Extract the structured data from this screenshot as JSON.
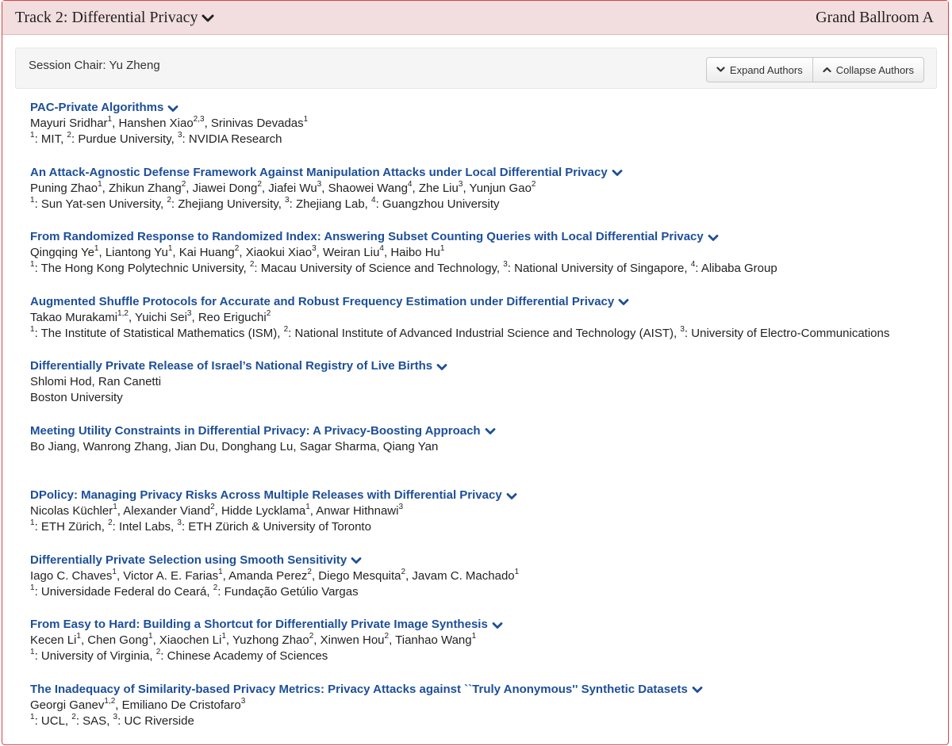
{
  "track": {
    "title": "Track 2: Differential Privacy",
    "room": "Grand Ballroom A"
  },
  "session": {
    "chair": "Session Chair: Yu Zheng",
    "expand_label": "Expand Authors",
    "collapse_label": "Collapse Authors"
  },
  "icons": {
    "track_toggle": "chevron-down-icon",
    "expand": "chevron-down-icon",
    "collapse": "chevron-up-icon",
    "paper_toggle": "chevron-down-icon"
  },
  "colors": {
    "header_bg": "#f2dede",
    "border": "#d8434a",
    "link": "#1d4f99"
  },
  "papers": [
    {
      "title": "PAC-Private Algorithms",
      "authors": [
        {
          "name": "Mayuri Sridhar",
          "sup": "1"
        },
        {
          "name": "Hanshen Xiao",
          "sup": "2,3"
        },
        {
          "name": "Srinivas Devadas",
          "sup": "1"
        }
      ],
      "affiliations": [
        {
          "sup": "1",
          "name": "MIT"
        },
        {
          "sup": "2",
          "name": "Purdue University"
        },
        {
          "sup": "3",
          "name": "NVIDIA Research"
        }
      ]
    },
    {
      "title": "An Attack-Agnostic Defense Framework Against Manipulation Attacks under Local Differential Privacy",
      "authors": [
        {
          "name": "Puning Zhao",
          "sup": "1"
        },
        {
          "name": "Zhikun Zhang",
          "sup": "2"
        },
        {
          "name": "Jiawei Dong",
          "sup": "2"
        },
        {
          "name": "Jiafei Wu",
          "sup": "3"
        },
        {
          "name": "Shaowei Wang",
          "sup": "4"
        },
        {
          "name": "Zhe Liu",
          "sup": "3"
        },
        {
          "name": "Yunjun Gao",
          "sup": "2"
        }
      ],
      "affiliations": [
        {
          "sup": "1",
          "name": "Sun Yat-sen University"
        },
        {
          "sup": "2",
          "name": "Zhejiang University"
        },
        {
          "sup": "3",
          "name": "Zhejiang Lab"
        },
        {
          "sup": "4",
          "name": "Guangzhou University"
        }
      ]
    },
    {
      "title": "From Randomized Response to Randomized Index: Answering Subset Counting Queries with Local Differential Privacy",
      "authors": [
        {
          "name": "Qingqing Ye",
          "sup": "1"
        },
        {
          "name": "Liantong Yu",
          "sup": "1"
        },
        {
          "name": "Kai Huang",
          "sup": "2"
        },
        {
          "name": "Xiaokui Xiao",
          "sup": "3"
        },
        {
          "name": "Weiran Liu",
          "sup": "4"
        },
        {
          "name": "Haibo Hu",
          "sup": "1"
        }
      ],
      "affiliations": [
        {
          "sup": "1",
          "name": "The Hong Kong Polytechnic University"
        },
        {
          "sup": "2",
          "name": "Macau University of Science and Technology"
        },
        {
          "sup": "3",
          "name": "National University of Singapore"
        },
        {
          "sup": "4",
          "name": "Alibaba Group"
        }
      ]
    },
    {
      "title": "Augmented Shuffle Protocols for Accurate and Robust Frequency Estimation under Differential Privacy",
      "authors": [
        {
          "name": "Takao Murakami",
          "sup": "1,2"
        },
        {
          "name": "Yuichi Sei",
          "sup": "3"
        },
        {
          "name": "Reo Eriguchi",
          "sup": "2"
        }
      ],
      "affiliations": [
        {
          "sup": "1",
          "name": "The Institute of Statistical Mathematics (ISM)"
        },
        {
          "sup": "2",
          "name": "National Institute of Advanced Industrial Science and Technology (AIST)"
        },
        {
          "sup": "3",
          "name": "University of Electro-Communications"
        }
      ]
    },
    {
      "title": "Differentially Private Release of Israel’s National Registry of Live Births",
      "authors": [
        {
          "name": "Shlomi Hod",
          "sup": ""
        },
        {
          "name": "Ran Canetti",
          "sup": ""
        }
      ],
      "affiliations": [
        {
          "sup": "",
          "name": "Boston University"
        }
      ]
    },
    {
      "title": "Meeting Utility Constraints in Differential Privacy: A Privacy-Boosting Approach",
      "authors": [
        {
          "name": "Bo Jiang",
          "sup": ""
        },
        {
          "name": "Wanrong Zhang",
          "sup": ""
        },
        {
          "name": "Jian Du",
          "sup": ""
        },
        {
          "name": "Donghang Lu",
          "sup": ""
        },
        {
          "name": "Sagar Sharma",
          "sup": ""
        },
        {
          "name": "Qiang Yan",
          "sup": ""
        }
      ],
      "affiliations": []
    },
    {
      "title": "DPolicy: Managing Privacy Risks Across Multiple Releases with Differential Privacy",
      "authors": [
        {
          "name": "Nicolas Küchler",
          "sup": "1"
        },
        {
          "name": "Alexander Viand",
          "sup": "2"
        },
        {
          "name": "Hidde Lycklama",
          "sup": "1"
        },
        {
          "name": "Anwar Hithnawi",
          "sup": "3"
        }
      ],
      "affiliations": [
        {
          "sup": "1",
          "name": "ETH Zürich"
        },
        {
          "sup": "2",
          "name": "Intel Labs"
        },
        {
          "sup": "3",
          "name": "ETH Zürich & University of Toronto"
        }
      ]
    },
    {
      "title": "Differentially Private Selection using Smooth Sensitivity",
      "authors": [
        {
          "name": "Iago C. Chaves",
          "sup": "1"
        },
        {
          "name": "Victor A. E. Farias",
          "sup": "1"
        },
        {
          "name": "Amanda Perez",
          "sup": "2"
        },
        {
          "name": "Diego Mesquita",
          "sup": "2"
        },
        {
          "name": "Javam C. Machado",
          "sup": "1"
        }
      ],
      "affiliations": [
        {
          "sup": "1",
          "name": "Universidade Federal do Ceará"
        },
        {
          "sup": "2",
          "name": "Fundação Getúlio Vargas"
        }
      ]
    },
    {
      "title": "From Easy to Hard: Building a Shortcut for Differentially Private Image Synthesis",
      "authors": [
        {
          "name": "Kecen Li",
          "sup": "1"
        },
        {
          "name": "Chen Gong",
          "sup": "1"
        },
        {
          "name": "Xiaochen Li",
          "sup": "1"
        },
        {
          "name": "Yuzhong Zhao",
          "sup": "2"
        },
        {
          "name": "Xinwen Hou",
          "sup": "2"
        },
        {
          "name": "Tianhao Wang",
          "sup": "1"
        }
      ],
      "affiliations": [
        {
          "sup": "1",
          "name": "University of Virginia"
        },
        {
          "sup": "2",
          "name": "Chinese Academy of Sciences"
        }
      ]
    },
    {
      "title": "The Inadequacy of Similarity-based Privacy Metrics: Privacy Attacks against ``Truly Anonymous'' Synthetic Datasets",
      "authors": [
        {
          "name": "Georgi Ganev",
          "sup": "1,2"
        },
        {
          "name": "Emiliano De Cristofaro",
          "sup": "3"
        }
      ],
      "affiliations": [
        {
          "sup": "1",
          "name": "UCL"
        },
        {
          "sup": "2",
          "name": "SAS"
        },
        {
          "sup": "3",
          "name": "UC Riverside"
        }
      ]
    }
  ]
}
